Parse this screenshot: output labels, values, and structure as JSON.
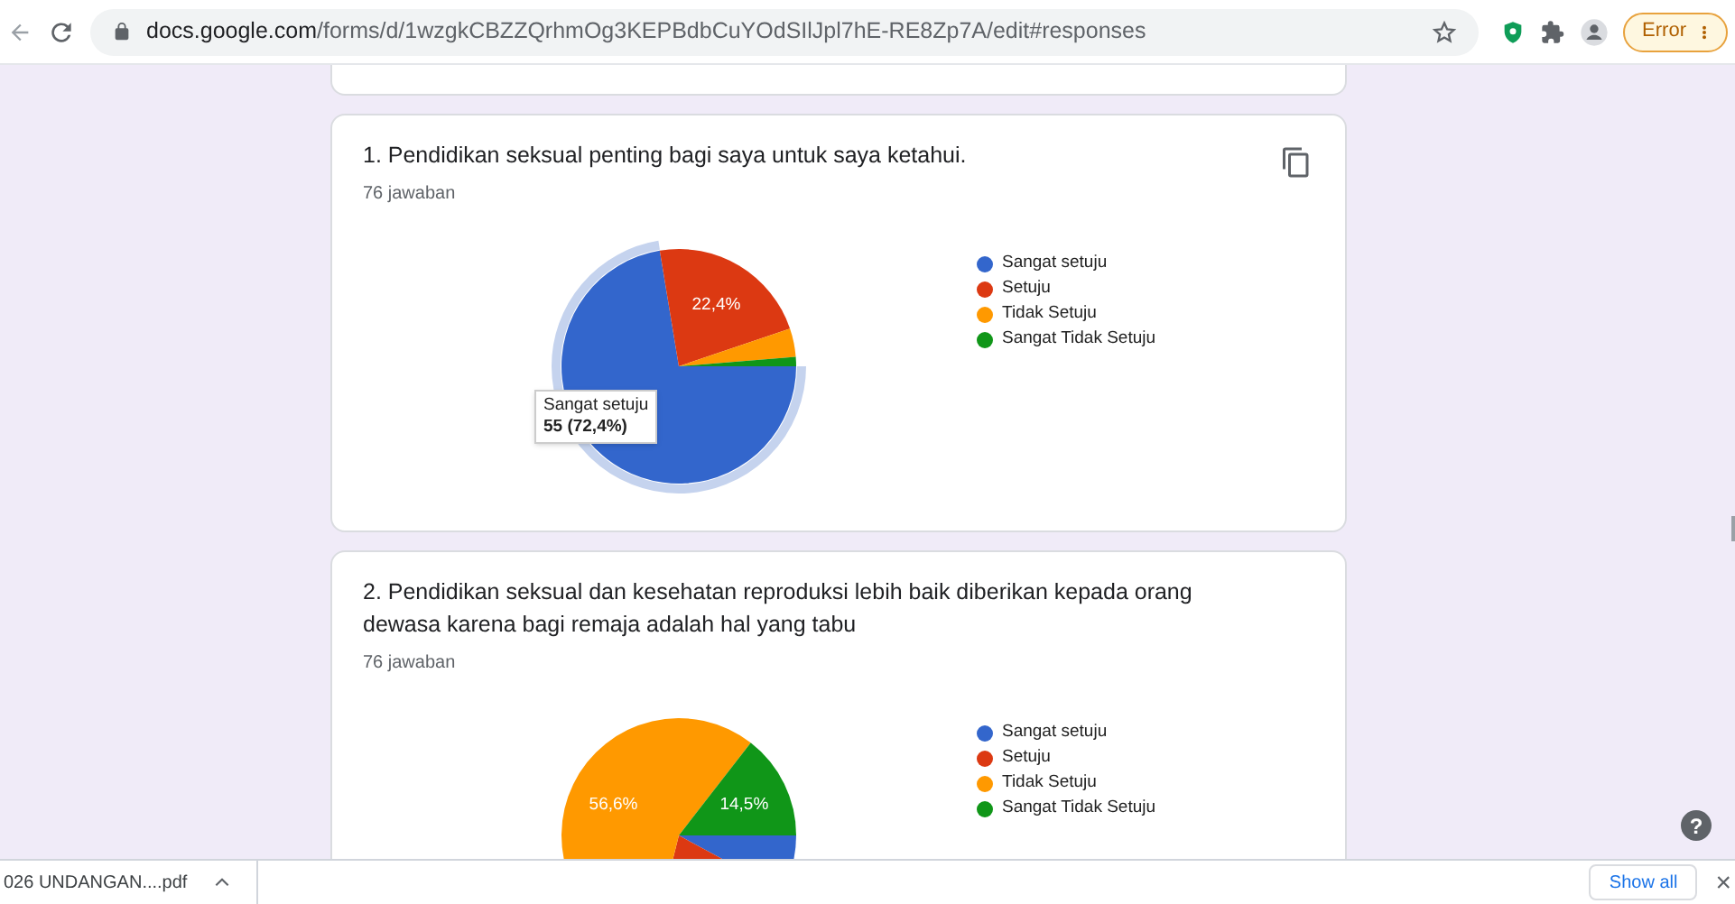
{
  "browser": {
    "url_domain": "docs.google.com",
    "url_path": "/forms/d/1wzgkCBZZQrhmOg3KEPBdbCuYOdSIlJpl7hE-RE8Zp7A/edit#responses",
    "profile_status": "Error"
  },
  "questions": [
    {
      "title": "1. Pendidikan seksual penting bagi saya untuk saya ketahui.",
      "responses": "76 jawaban",
      "copy_button": true,
      "slice_states": [
        {
          "highlighted": true
        },
        {
          "highlighted": false
        },
        {
          "highlighted": false
        },
        {
          "highlighted": false
        }
      ],
      "tooltip": {
        "title": "Sangat setuju",
        "value": "55 (72,4%)"
      },
      "chart_data": {
        "type": "pie",
        "categories": [
          "Sangat setuju",
          "Setuju",
          "Tidak Setuju",
          "Sangat Tidak Setuju"
        ],
        "series": [
          {
            "values": [
              72.4,
              22.4,
              3.9,
              1.3
            ]
          }
        ],
        "legend": true,
        "colors": [
          "#3366cc",
          "#dc3912",
          "#ff9900",
          "#109618"
        ],
        "value_labels": [
          null,
          "22,4%",
          null,
          null
        ]
      }
    },
    {
      "title": "2. Pendidikan seksual dan kesehatan reproduksi lebih baik diberikan kepada orang dewasa karena bagi remaja adalah hal yang tabu",
      "responses": "76 jawaban",
      "copy_button": false,
      "slice_states": [
        {
          "highlighted": false
        },
        {
          "highlighted": false
        },
        {
          "highlighted": false
        },
        {
          "highlighted": false
        }
      ],
      "chart_data": {
        "type": "pie",
        "categories": [
          "Sangat setuju",
          "Setuju",
          "Tidak Setuju",
          "Sangat Tidak Setuju"
        ],
        "series": [
          {
            "values": [
              7.9,
              21.0,
              56.6,
              14.5
            ]
          }
        ],
        "legend": true,
        "colors": [
          "#3366cc",
          "#dc3912",
          "#ff9900",
          "#109618"
        ],
        "value_labels": [
          null,
          null,
          "56,6%",
          "14,5%"
        ]
      }
    }
  ],
  "downloads": {
    "file": "026 UNDANGAN....pdf",
    "show_all": "Show all",
    "close": "×"
  },
  "help": "?"
}
